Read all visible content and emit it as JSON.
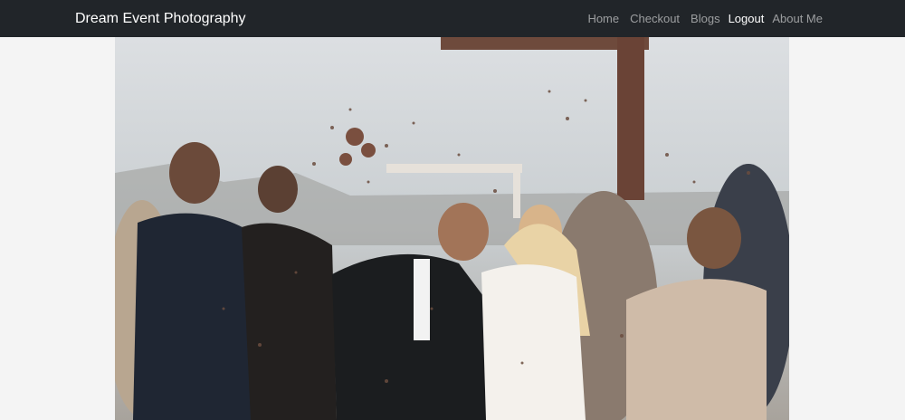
{
  "navbar": {
    "brand": "Dream Event Photography",
    "links": [
      {
        "label": "Home",
        "active": false
      },
      {
        "label": "Checkout",
        "active": false
      },
      {
        "label": "Blogs",
        "active": false
      },
      {
        "label": "Logout",
        "active": true
      },
      {
        "label": "About Me",
        "active": false
      }
    ]
  },
  "colors": {
    "navbar_bg": "#212529",
    "page_bg": "#f4f4f4",
    "link_muted": "rgba(255,255,255,0.55)",
    "link_active": "#ffffff"
  }
}
